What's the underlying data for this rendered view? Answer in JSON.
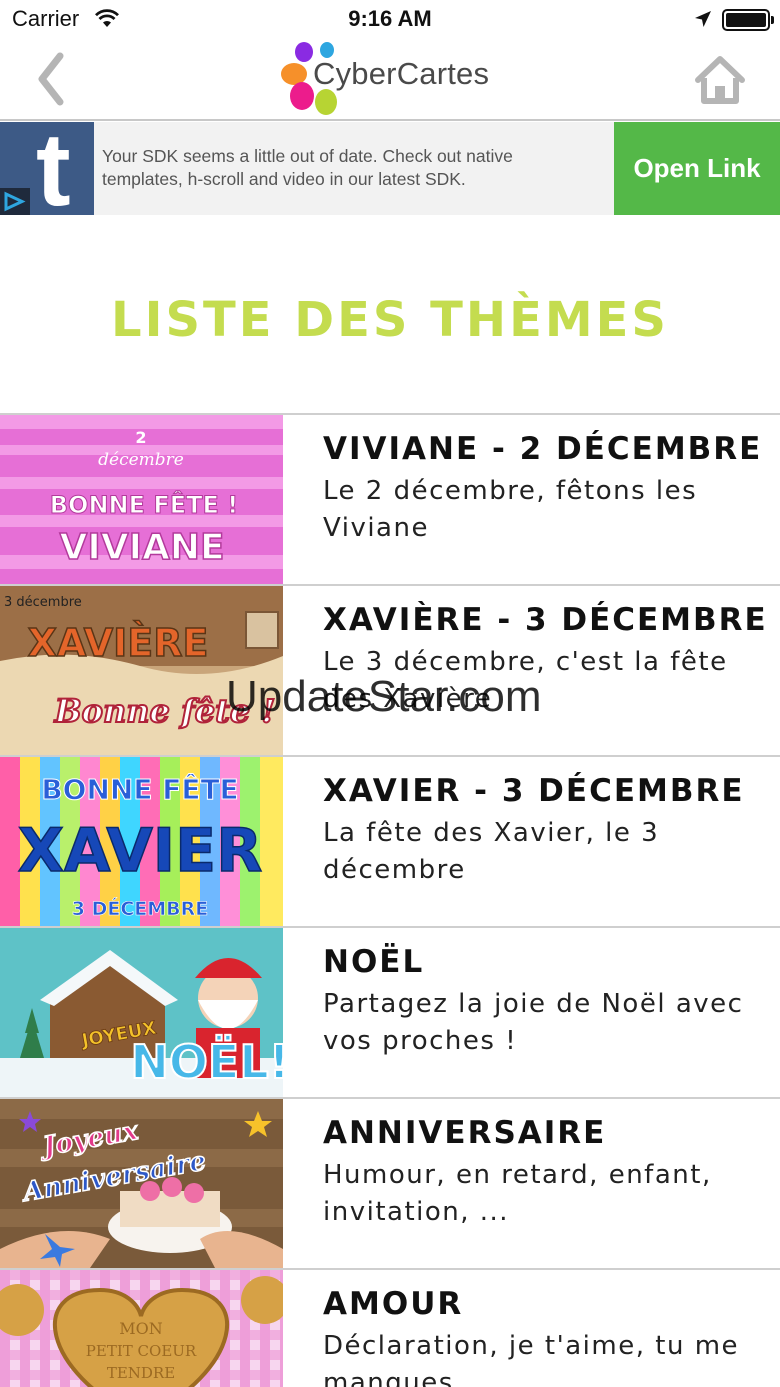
{
  "status_bar": {
    "carrier": "Carrier",
    "time": "9:16 AM"
  },
  "nav": {
    "logo_text": "CyberCartes",
    "back_icon": "chevron-left-icon",
    "home_icon": "home-icon"
  },
  "ad": {
    "thumb_letter": "t",
    "text": "Your SDK seems a little out of date. Check out native templates, h-scroll and video in our latest SDK.",
    "button_label": "Open Link",
    "button_color": "#54b848"
  },
  "page_title": "LISTE DES THÈMES",
  "title_color": "#c4dc4f",
  "themes": [
    {
      "title": "VIVIANE - 2 DÉCEMBRE",
      "description": "Le 2 décembre, fêtons les Viviane",
      "thumb_lines": [
        "2",
        "décembre",
        "BONNE FÊTE !",
        "VIVIANE"
      ]
    },
    {
      "title": "XAVIÈRE - 3 DÉCEMBRE",
      "description": "Le 3 décembre, c'est la fête des Xavière",
      "thumb_lines": [
        "3 décembre",
        "XAVIÈRE",
        "Bonne fête !"
      ]
    },
    {
      "title": "XAVIER - 3 DÉCEMBRE",
      "description": "La fête des Xavier, le 3 décembre",
      "thumb_lines": [
        "BONNE FÊTE",
        "XAVIER",
        "3 DÉCEMBRE"
      ]
    },
    {
      "title": "NOËL",
      "description": "Partagez la joie de Noël avec vos proches !",
      "thumb_lines": [
        "JOYEUX",
        "NOËL!"
      ]
    },
    {
      "title": "ANNIVERSAIRE",
      "description": "Humour, en retard, enfant, invitation, ...",
      "thumb_lines": [
        "Joyeux",
        "Anniversaire"
      ]
    },
    {
      "title": "AMOUR",
      "description": "Déclaration, je t'aime, tu me manques...",
      "thumb_lines": [
        "MON",
        "PETIT COEUR",
        "TENDRE"
      ]
    }
  ],
  "watermark": "UpdateStar.com"
}
